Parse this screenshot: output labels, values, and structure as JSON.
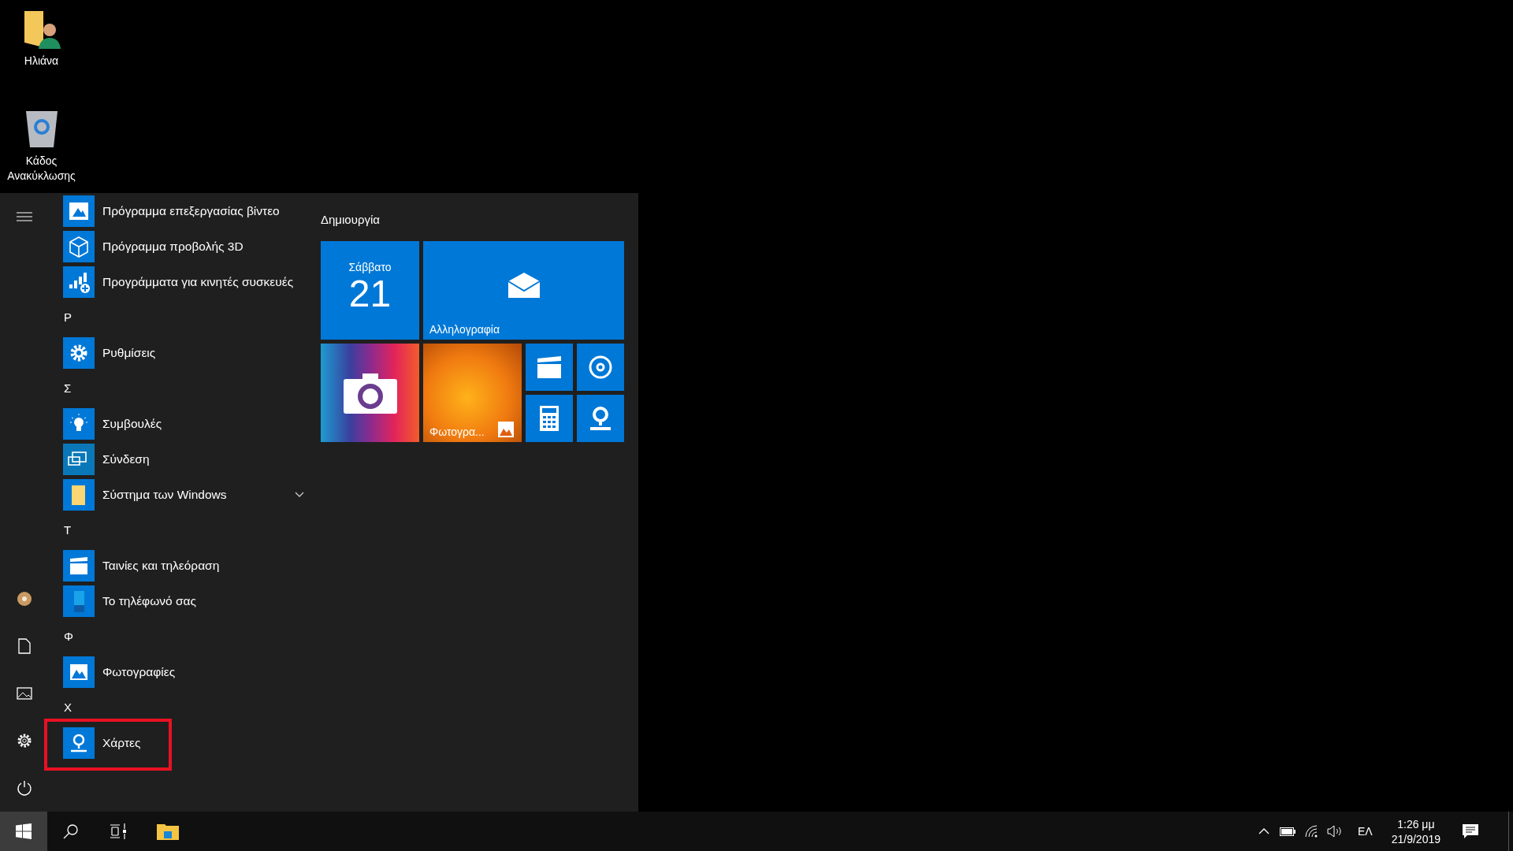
{
  "desktop_icons": [
    {
      "kind": "user-folder",
      "label": "Ηλιάνα"
    },
    {
      "kind": "recycle-bin",
      "label": "Κάδος Ανακύκλωσης"
    }
  ],
  "start_menu": {
    "app_sections": [
      {
        "apps": [
          {
            "kind": "app",
            "label": "Πρόγραμμα επεξεργασίας βίντεο",
            "highlighted": false
          },
          {
            "kind": "app",
            "label": "Πρόγραμμα προβολής 3D",
            "highlighted": false
          },
          {
            "kind": "app",
            "label": "Προγράμματα για κινητές συσκευές",
            "highlighted": false
          }
        ]
      },
      {
        "letter": "Ρ",
        "apps": [
          {
            "kind": "app",
            "label": "Ρυθμίσεις",
            "highlighted": false
          }
        ]
      },
      {
        "letter": "Σ",
        "apps": [
          {
            "kind": "app",
            "label": "Συμβουλές",
            "highlighted": false
          },
          {
            "kind": "app",
            "label": "Σύνδεση",
            "highlighted": false
          },
          {
            "kind": "folder",
            "label": "Σύστημα των Windows",
            "expanded": false,
            "highlighted": false
          }
        ]
      },
      {
        "letter": "Τ",
        "apps": [
          {
            "kind": "app",
            "label": "Ταινίες και τηλεόραση",
            "highlighted": false
          },
          {
            "kind": "app",
            "label": "Το τηλέφωνό σας",
            "highlighted": false
          }
        ]
      },
      {
        "letter": "Φ",
        "apps": [
          {
            "kind": "app",
            "label": "Φωτογραφίες",
            "highlighted": false
          }
        ]
      },
      {
        "letter": "Χ",
        "apps": [
          {
            "kind": "app",
            "label": "Χάρτες",
            "highlighted": true
          }
        ]
      }
    ],
    "tile_group": {
      "title": "Δημιουργία",
      "tiles": [
        {
          "kind": "calendar",
          "weekday": "Σάββατο",
          "day": "21"
        },
        {
          "kind": "mail",
          "label": "Αλληλογραφία"
        },
        {
          "kind": "camera"
        },
        {
          "kind": "photos",
          "label": "Φωτογρα..."
        },
        {
          "kind": "movies"
        },
        {
          "kind": "music"
        },
        {
          "kind": "calculator"
        },
        {
          "kind": "maps"
        }
      ]
    }
  },
  "taskbar": {
    "start_active": true,
    "language": "ΕΛ",
    "time": "1:26 μμ",
    "date": "21/9/2019"
  }
}
